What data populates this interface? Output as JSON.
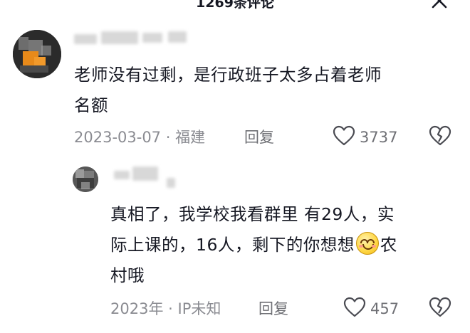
{
  "header": {
    "title": "1269条评论"
  },
  "comments": [
    {
      "text": "老师没有过剩，是行政班子太多占着老师\n名额",
      "date": "2023-03-07",
      "location": "福建",
      "reply_label": "回复",
      "likes": "3737"
    },
    {
      "text_before_emoji": "真相了，我学校我看群里 有29人，实\n际上课的，16人，剩下的你想想",
      "text_after_emoji": "农\n村哦",
      "date": "2023年",
      "location": "IP未知",
      "reply_label": "回复",
      "likes": "457"
    }
  ],
  "icons": {
    "close": "close-icon",
    "like": "heart-icon",
    "dislike": "broken-heart-icon",
    "emoji": "smile-emoji-icon"
  }
}
